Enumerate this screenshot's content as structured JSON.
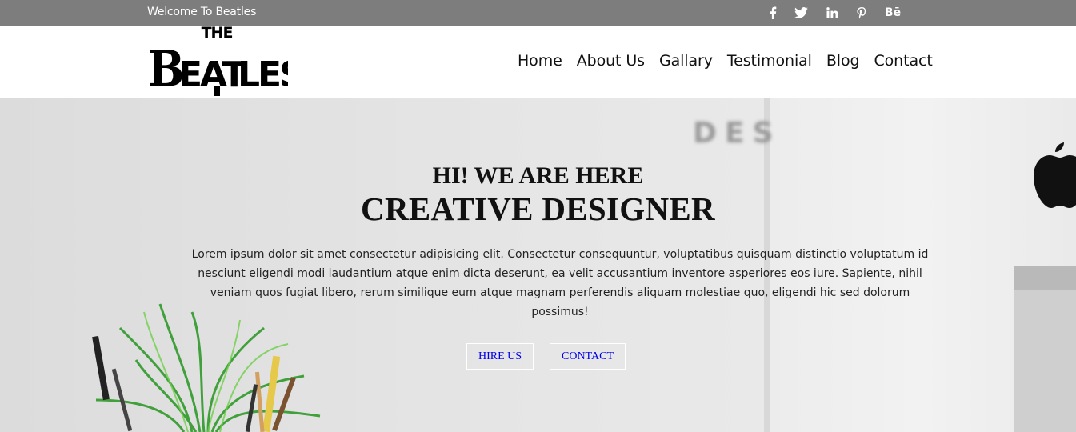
{
  "topbar": {
    "welcome": "Welcome To Beatles",
    "social": [
      {
        "name": "facebook-icon",
        "glyph": "f"
      },
      {
        "name": "twitter-icon",
        "glyph": "t"
      },
      {
        "name": "linkedin-icon",
        "glyph": "in"
      },
      {
        "name": "pinterest-icon",
        "glyph": "p"
      },
      {
        "name": "behance-icon",
        "glyph": "Bē"
      }
    ]
  },
  "header": {
    "logo_top": "THE",
    "logo_main": "BEATLES",
    "nav": [
      "Home",
      "About Us",
      "Gallary",
      "Testimonial",
      "Blog",
      "Contact"
    ]
  },
  "hero": {
    "background_text": "DES",
    "subtitle": "HI! WE ARE HERE",
    "title": "CREATIVE DESIGNER",
    "description": "Lorem ipsum dolor sit amet consectetur adipisicing elit. Consectetur consequuntur, voluptatibus quisquam distinctio voluptatum id nesciunt eligendi modi laudantium atque enim dicta deserunt, ea velit accusantium inventore asperiores eos iure. Sapiente, nihil veniam quos fugiat libero, rerum similique eum atque magnam perferendis aliquam molestiae quo, eligendi hic sed dolorum possimus!",
    "buttons": {
      "hire": "HIRE US",
      "contact": "CONTACT"
    }
  },
  "colors": {
    "topbar": "#7d7d7d",
    "button_text": "#0000ee"
  }
}
